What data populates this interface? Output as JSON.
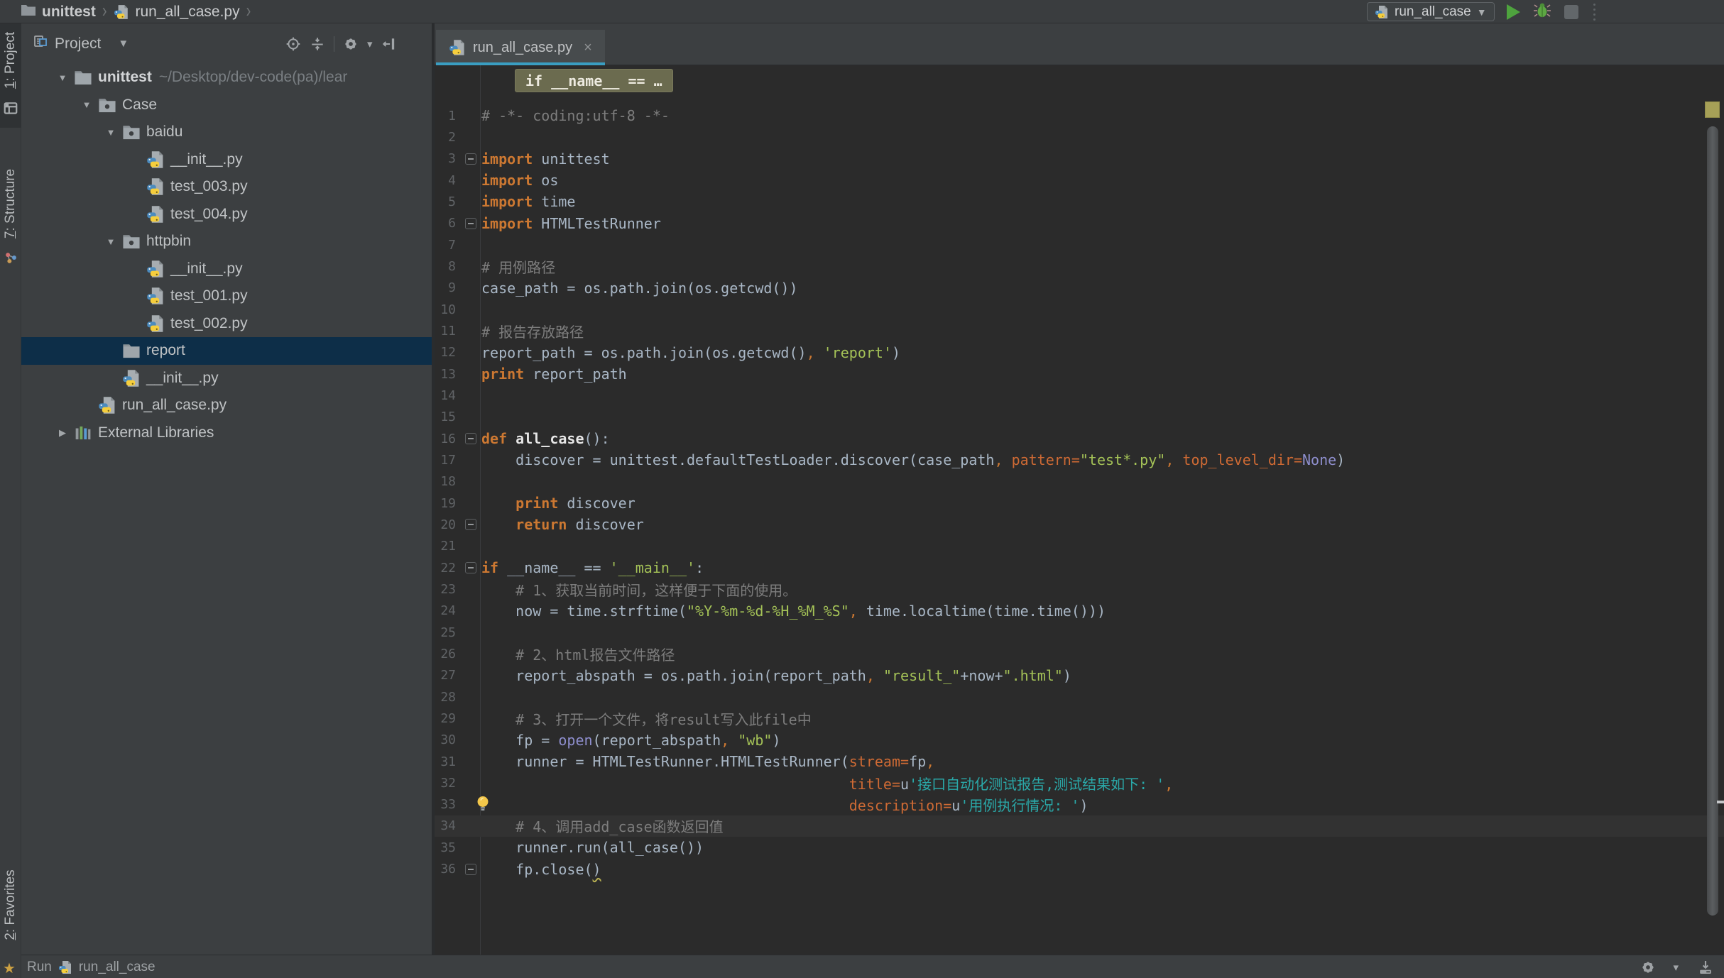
{
  "topbar": {
    "breadcrumb_root": "unittest",
    "breadcrumb_file": "run_all_case.py",
    "run_config": "run_all_case"
  },
  "stripe": {
    "project_mnemonic": "1",
    "project_label": ": Project",
    "structure_mnemonic": "7",
    "structure_label": ": Structure",
    "favorites_mnemonic": "2",
    "favorites_label": ": Favorites"
  },
  "project_panel": {
    "title": "Project",
    "tree": [
      {
        "label": "unittest",
        "suffix": "~/Desktop/dev-code(pa)/lear",
        "depth": 0,
        "icon": "folder",
        "arrow": "open",
        "bold": true
      },
      {
        "label": "Case",
        "depth": 1,
        "icon": "package",
        "arrow": "open"
      },
      {
        "label": "baidu",
        "depth": 2,
        "icon": "package",
        "arrow": "open"
      },
      {
        "label": "__init__.py",
        "depth": 3,
        "icon": "python"
      },
      {
        "label": "test_003.py",
        "depth": 3,
        "icon": "python"
      },
      {
        "label": "test_004.py",
        "depth": 3,
        "icon": "python"
      },
      {
        "label": "httpbin",
        "depth": 2,
        "icon": "package",
        "arrow": "open"
      },
      {
        "label": "__init__.py",
        "depth": 3,
        "icon": "python"
      },
      {
        "label": "test_001.py",
        "depth": 3,
        "icon": "python"
      },
      {
        "label": "test_002.py",
        "depth": 3,
        "icon": "python"
      },
      {
        "label": "report",
        "depth": 2,
        "icon": "folder",
        "selected": true
      },
      {
        "label": "__init__.py",
        "depth": 2,
        "icon": "python"
      },
      {
        "label": "run_all_case.py",
        "depth": 1,
        "icon": "python"
      },
      {
        "label": "External Libraries",
        "depth": 0,
        "icon": "library",
        "arrow": "closed"
      }
    ]
  },
  "editor": {
    "tab_title": "run_all_case.py",
    "context_info": "if __name__ == …",
    "lines": [
      {
        "n": 1,
        "tokens": [
          [
            "c",
            "# -*- coding:utf-8 -*-"
          ]
        ]
      },
      {
        "n": 2,
        "tokens": []
      },
      {
        "n": 3,
        "fold": "start",
        "tokens": [
          [
            "k",
            "import"
          ],
          [
            "d",
            " unittest"
          ]
        ]
      },
      {
        "n": 4,
        "tokens": [
          [
            "k",
            "import"
          ],
          [
            "d",
            " os"
          ]
        ]
      },
      {
        "n": 5,
        "tokens": [
          [
            "k",
            "import"
          ],
          [
            "d",
            " time"
          ]
        ]
      },
      {
        "n": 6,
        "fold": "end",
        "tokens": [
          [
            "k",
            "import"
          ],
          [
            "d",
            " HTMLTestRunner"
          ]
        ]
      },
      {
        "n": 7,
        "tokens": []
      },
      {
        "n": 8,
        "tokens": [
          [
            "c",
            "# 用例路径"
          ]
        ]
      },
      {
        "n": 9,
        "tokens": [
          [
            "d",
            "case_path = os.path.join(os.getcwd())"
          ]
        ]
      },
      {
        "n": 10,
        "tokens": []
      },
      {
        "n": 11,
        "tokens": [
          [
            "c",
            "# 报告存放路径"
          ]
        ]
      },
      {
        "n": 12,
        "tokens": [
          [
            "d",
            "report_path = os.path.join(os.getcwd()"
          ],
          [
            "o",
            ","
          ],
          [
            "d",
            " "
          ],
          [
            "s",
            "'report'"
          ],
          [
            "d",
            ")"
          ]
        ]
      },
      {
        "n": 13,
        "tokens": [
          [
            "k",
            "print"
          ],
          [
            "d",
            " report_path"
          ]
        ]
      },
      {
        "n": 14,
        "tokens": []
      },
      {
        "n": 15,
        "tokens": []
      },
      {
        "n": 16,
        "fold": "start",
        "tokens": [
          [
            "k",
            "def"
          ],
          [
            "d",
            " "
          ],
          [
            "f",
            "all_case"
          ],
          [
            "d",
            "():"
          ]
        ]
      },
      {
        "n": 17,
        "tokens": [
          [
            "d",
            "    discover = unittest.defaultTestLoader.discover(case_path"
          ],
          [
            "o",
            ","
          ],
          [
            "d",
            " "
          ],
          [
            "a",
            "pattern="
          ],
          [
            "s",
            "\"test*.py\""
          ],
          [
            "o",
            ","
          ],
          [
            "d",
            " "
          ],
          [
            "a",
            "top_level_dir="
          ],
          [
            "b",
            "None"
          ],
          [
            "d",
            ")"
          ]
        ]
      },
      {
        "n": 18,
        "tokens": []
      },
      {
        "n": 19,
        "tokens": [
          [
            "d",
            "    "
          ],
          [
            "k",
            "print"
          ],
          [
            "d",
            " discover"
          ]
        ]
      },
      {
        "n": 20,
        "fold": "end",
        "tokens": [
          [
            "d",
            "    "
          ],
          [
            "k",
            "return"
          ],
          [
            "d",
            " discover"
          ]
        ]
      },
      {
        "n": 21,
        "tokens": []
      },
      {
        "n": 22,
        "fold": "start",
        "tokens": [
          [
            "k",
            "if"
          ],
          [
            "d",
            " __name__ == "
          ],
          [
            "s",
            "'__main__'"
          ],
          [
            "d",
            ":"
          ]
        ]
      },
      {
        "n": 23,
        "tokens": [
          [
            "c",
            "    # 1、获取当前时间，这样便于下面的使用。"
          ]
        ]
      },
      {
        "n": 24,
        "tokens": [
          [
            "d",
            "    now = time.strftime("
          ],
          [
            "s",
            "\"%Y-%m-%d-%H_%M_%S\""
          ],
          [
            "o",
            ","
          ],
          [
            "d",
            " time.localtime(time.time()))"
          ]
        ]
      },
      {
        "n": 25,
        "tokens": []
      },
      {
        "n": 26,
        "tokens": [
          [
            "c",
            "    # 2、html报告文件路径"
          ]
        ]
      },
      {
        "n": 27,
        "tokens": [
          [
            "d",
            "    report_abspath = os.path.join(report_path"
          ],
          [
            "o",
            ","
          ],
          [
            "d",
            " "
          ],
          [
            "s",
            "\"result_\""
          ],
          [
            "d",
            "+now+"
          ],
          [
            "s",
            "\".html\""
          ],
          [
            "d",
            ")"
          ]
        ]
      },
      {
        "n": 28,
        "tokens": []
      },
      {
        "n": 29,
        "tokens": [
          [
            "c",
            "    # 3、打开一个文件，将result写入此file中"
          ]
        ]
      },
      {
        "n": 30,
        "tokens": [
          [
            "d",
            "    fp = "
          ],
          [
            "b",
            "open"
          ],
          [
            "d",
            "(report_abspath"
          ],
          [
            "o",
            ","
          ],
          [
            "d",
            " "
          ],
          [
            "s",
            "\"wb\""
          ],
          [
            "d",
            ")"
          ]
        ]
      },
      {
        "n": 31,
        "tokens": [
          [
            "d",
            "    runner = HTMLTestRunner.HTMLTestRunner("
          ],
          [
            "a",
            "stream="
          ],
          [
            "d",
            "fp"
          ],
          [
            "o",
            ","
          ]
        ]
      },
      {
        "n": 32,
        "tokens": [
          [
            "d",
            "                                           "
          ],
          [
            "a",
            "title="
          ],
          [
            "d",
            "u"
          ],
          [
            "ts",
            "'接口自动化测试报告,测试结果如下: '"
          ],
          [
            "o",
            ","
          ]
        ]
      },
      {
        "n": 33,
        "bulb": true,
        "tokens": [
          [
            "d",
            "                                           "
          ],
          [
            "a",
            "description="
          ],
          [
            "d",
            "u"
          ],
          [
            "ts",
            "'用例执行情况: '"
          ],
          [
            "d",
            ")"
          ]
        ]
      },
      {
        "n": 34,
        "current": true,
        "tokens": [
          [
            "c",
            "    # 4、调用add_case函数返回值"
          ]
        ]
      },
      {
        "n": 35,
        "tokens": [
          [
            "d",
            "    runner.run(all_case())"
          ]
        ]
      },
      {
        "n": 36,
        "fold": "end",
        "tokens": [
          [
            "d",
            "    fp.close("
          ],
          [
            "w",
            ")"
          ]
        ]
      }
    ]
  },
  "statusbar": {
    "prefix": "Run",
    "config": "run_all_case"
  },
  "colors": {
    "tab_underline": "#3A9EC2",
    "tree_selection": "#0D2E48",
    "keyword": "#CC7832",
    "string": "#A4C257",
    "unicode_string": "#2AA8A8",
    "comment": "#7D7D7D",
    "builtin": "#8E8ECD",
    "kwarg": "#CE6A34",
    "default_text": "#A9B7C6",
    "editor_bg": "#2B2B2B",
    "panel_bg": "#3C3F41"
  }
}
